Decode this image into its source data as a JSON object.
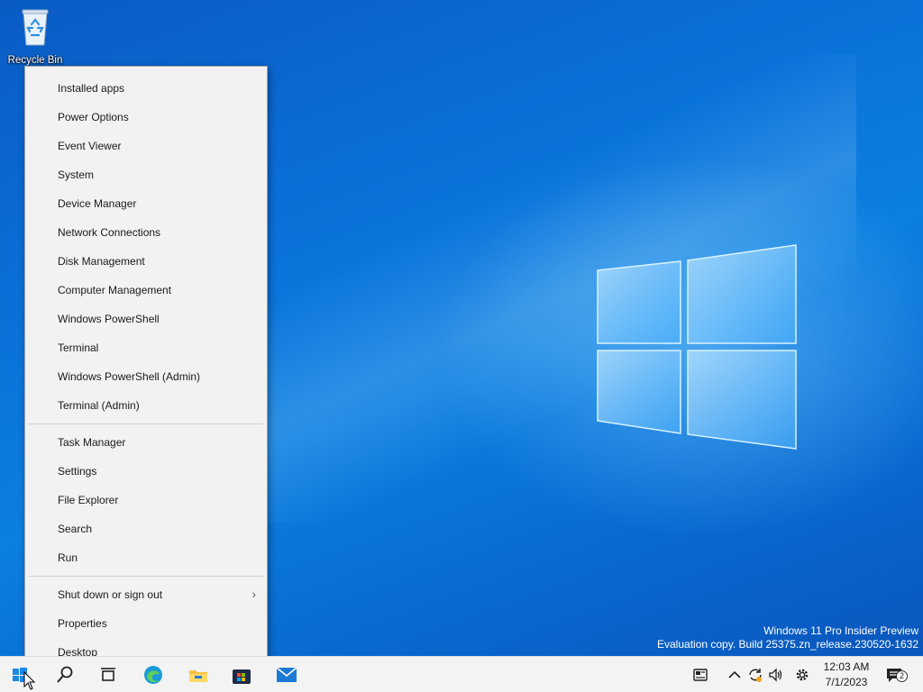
{
  "desktop": {
    "icons": [
      {
        "label": "Recycle Bin",
        "icon": "recycle-bin-icon"
      }
    ],
    "watermark": {
      "line1": "Windows 11 Pro Insider Preview",
      "line2": "Evaluation copy. Build 25375.zn_release.230520-1632"
    }
  },
  "context_menu": {
    "group1": [
      "Installed apps",
      "Power Options",
      "Event Viewer",
      "System",
      "Device Manager",
      "Network Connections",
      "Disk Management",
      "Computer Management",
      "Windows PowerShell",
      "Terminal",
      "Windows PowerShell (Admin)",
      "Terminal (Admin)"
    ],
    "group2": [
      "Task Manager",
      "Settings",
      "File Explorer",
      "Search",
      "Run"
    ],
    "group3": [
      {
        "label": "Shut down or sign out",
        "submenu": "›"
      },
      {
        "label": "Properties"
      },
      {
        "label": "Desktop"
      }
    ]
  },
  "taskbar": {
    "pinned": [
      "start-icon",
      "search-icon",
      "task-view-icon",
      "edge-icon",
      "file-explorer-icon",
      "store-icon",
      "mail-icon"
    ],
    "tray": [
      "news-icon",
      "chevron-up-icon",
      "sync-icon",
      "volume-icon",
      "settings-icon"
    ],
    "time": "12:03 AM",
    "date": "7/1/2023",
    "notification_count": "2"
  },
  "colors": {
    "accent": "#0078d4",
    "wallpaper": "#0a6fd8",
    "menu_bg": "#f2f2f2",
    "taskbar_bg": "#f3f3f3"
  }
}
